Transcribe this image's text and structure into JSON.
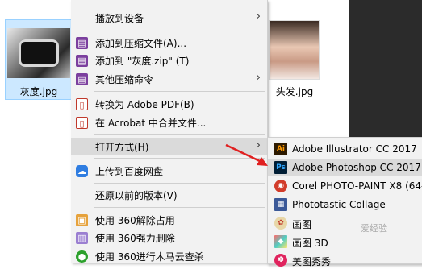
{
  "files": [
    {
      "name": "灰度.jpg"
    },
    {
      "name": "头发.jpg"
    }
  ],
  "menu": {
    "items": [
      {
        "label": "播放到设备",
        "icon": "cast-icon"
      },
      {
        "label": "添加到压缩文件(A)...",
        "icon": "winrar-icon"
      },
      {
        "label": "添加到 \"灰度.zip\" (T)",
        "icon": "winrar-icon"
      },
      {
        "label": "其他压缩命令",
        "icon": "winrar-icon"
      },
      {
        "label": "转换为 Adobe PDF(B)",
        "icon": "pdf-icon"
      },
      {
        "label": "在 Acrobat 中合并文件...",
        "icon": "pdf-combine-icon"
      },
      {
        "label": "打开方式(H)",
        "icon": ""
      },
      {
        "label": "上传到百度网盘",
        "icon": "baidu-cloud-icon"
      },
      {
        "label": "还原以前的版本(V)",
        "icon": ""
      },
      {
        "label": "使用 360解除占用",
        "icon": "unlock-icon"
      },
      {
        "label": "使用 360强力删除",
        "icon": "shred-icon"
      },
      {
        "label": "使用 360进行木马云查杀",
        "icon": "360-scan-icon"
      }
    ]
  },
  "open_with": {
    "items": [
      {
        "label": "Adobe Illustrator CC 2017",
        "icon_text": "Ai"
      },
      {
        "label": "Adobe Photoshop CC 2017",
        "icon_text": "Ps"
      },
      {
        "label": "Corel PHOTO-PAINT X8 (64-",
        "icon_text": ""
      },
      {
        "label": "Phototastic Collage",
        "icon_text": ""
      },
      {
        "label": "画图",
        "icon_text": ""
      },
      {
        "label": "画图 3D",
        "icon_text": ""
      },
      {
        "label": "美图秀秀",
        "icon_text": ""
      }
    ]
  },
  "watermark": "爱经验"
}
